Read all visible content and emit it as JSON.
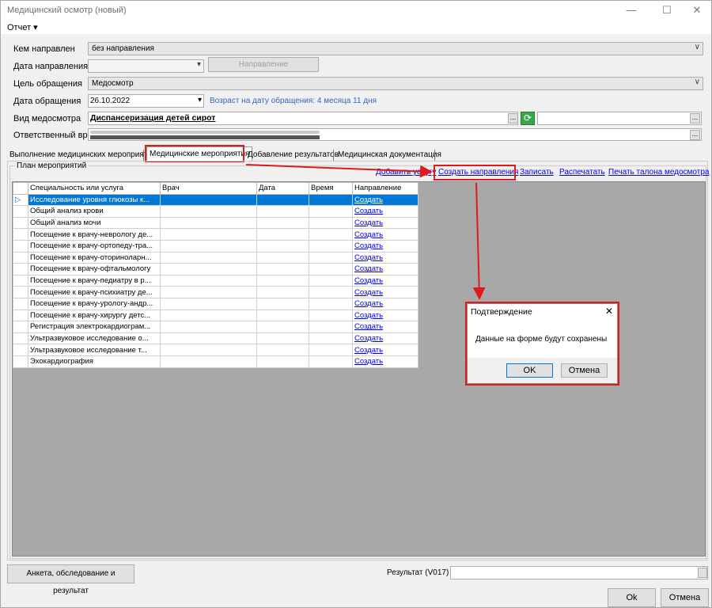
{
  "window": {
    "title": "Медицинский осмотр (новый)",
    "minimize_glyph": "—",
    "maximize_glyph": "☐",
    "close_glyph": "✕"
  },
  "menu": {
    "report": "Отчет ▾"
  },
  "form": {
    "referred_by_label": "Кем направлен",
    "referred_by_value": "без направления",
    "referral_date_label": "Дата направления",
    "referral_button": "Направление",
    "purpose_label": "Цель обращения",
    "purpose_value": "Медосмотр",
    "visit_date_label": "Дата обращения",
    "visit_date_value": "26.10.2022",
    "age_text": "Возраст на дату обращения: 4 месяца 11 дня",
    "exam_type_label": "Вид медосмотра",
    "exam_type_value": "Диспансеризация детей сирот",
    "doctor_label": "Ответственный врач",
    "ellipsis": "..."
  },
  "tabs": [
    "Выполнение медицинских мероприятий",
    "Медицинские мероприятия",
    "Добавление результатов",
    "Медицинская документация"
  ],
  "plan": {
    "group_label": "План мероприятий",
    "actions": {
      "add_service": "Добавить услугу",
      "create_referrals": "Создать направления",
      "save": "Записать",
      "print": "Распечатать",
      "print_ticket": "Печать талона медосмотра"
    },
    "columns": [
      "Специальность или услуга",
      "Врач",
      "Дата",
      "Время",
      "Направление"
    ],
    "row_marker": "▷",
    "rows": [
      {
        "service": "Исследование уровня глюкозы к...",
        "link": "Создать"
      },
      {
        "service": "Общий анализ крови",
        "link": "Создать"
      },
      {
        "service": "Общий анализ мочи",
        "link": "Создать"
      },
      {
        "service": "Посещение к врачу-неврологу де...",
        "link": "Создать"
      },
      {
        "service": "Посещение к врачу-ортопеду-тра...",
        "link": "Создать"
      },
      {
        "service": "Посещение к врачу-оториноларн...",
        "link": "Создать"
      },
      {
        "service": "Посещение к врачу-офтальмологу",
        "link": "Создать"
      },
      {
        "service": "Посещение к врачу-педиатру в р...",
        "link": "Создать"
      },
      {
        "service": "Посещение к врачу-психиатру де...",
        "link": "Создать"
      },
      {
        "service": "Посещение к врачу-урологу-андр...",
        "link": "Создать"
      },
      {
        "service": "Посещение к врачу-хирургу детс...",
        "link": "Создать"
      },
      {
        "service": "Регистрация электрокардиограм...",
        "link": "Создать"
      },
      {
        "service": "Ультразвуковое исследование о...",
        "link": "Создать"
      },
      {
        "service": "Ультразвуковое исследование т...",
        "link": "Создать"
      },
      {
        "service": "Эхокардиография",
        "link": "Создать"
      }
    ]
  },
  "dialog": {
    "title": "Подтверждение",
    "message": "Данные на форме будут сохранены",
    "ok": "OK",
    "cancel": "Отмена",
    "close_glyph": "✕"
  },
  "footer": {
    "survey_button": "Анкета, обследование и результат",
    "result_label": "Результат (V017)",
    "ok": "Ok",
    "cancel": "Отмена"
  },
  "colors": {
    "annotation": "#e01a1a",
    "selection": "#0078d7",
    "link": "#0000ee"
  }
}
